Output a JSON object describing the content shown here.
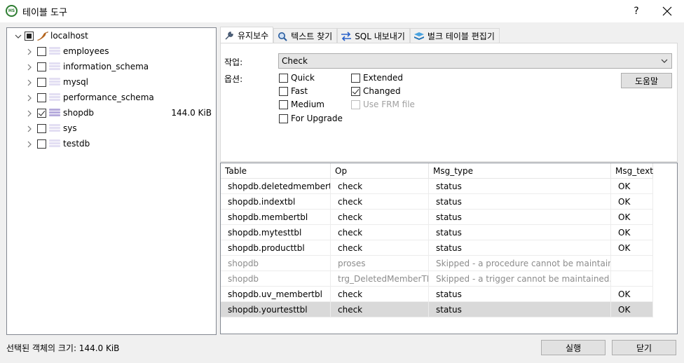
{
  "window": {
    "title": "테이블 도구",
    "help_label": "?",
    "app_icon_text": "HS"
  },
  "tree": {
    "root": {
      "label": "localhost",
      "state": "partial"
    },
    "items": [
      {
        "label": "employees",
        "checked": false,
        "size": ""
      },
      {
        "label": "information_schema",
        "checked": false,
        "size": ""
      },
      {
        "label": "mysql",
        "checked": false,
        "size": ""
      },
      {
        "label": "performance_schema",
        "checked": false,
        "size": ""
      },
      {
        "label": "shopdb",
        "checked": true,
        "size": "144.0 KiB"
      },
      {
        "label": "sys",
        "checked": false,
        "size": ""
      },
      {
        "label": "testdb",
        "checked": false,
        "size": ""
      }
    ]
  },
  "tabs": [
    {
      "label": "유지보수",
      "icon": "wrench-icon",
      "active": true
    },
    {
      "label": "텍스트 찾기",
      "icon": "magnifier-icon",
      "active": false
    },
    {
      "label": "SQL 내보내기",
      "icon": "export-arrows-icon",
      "active": false
    },
    {
      "label": "벌크 테이블 편집기",
      "icon": "stack-icon",
      "active": false
    }
  ],
  "maintenance": {
    "operation_label": "작업:",
    "operation_value": "Check",
    "options_label": "옵션:",
    "help_button": "도움말",
    "options": [
      {
        "label": "Quick",
        "checked": false,
        "disabled": false
      },
      {
        "label": "Fast",
        "checked": false,
        "disabled": false
      },
      {
        "label": "Medium",
        "checked": false,
        "disabled": false
      },
      {
        "label": "For Upgrade",
        "checked": false,
        "disabled": false
      },
      {
        "label": "Extended",
        "checked": false,
        "disabled": false
      },
      {
        "label": "Changed",
        "checked": true,
        "disabled": false
      },
      {
        "label": "Use FRM file",
        "checked": false,
        "disabled": true
      }
    ]
  },
  "results": {
    "columns": [
      "Table",
      "Op",
      "Msg_type",
      "Msg_text"
    ],
    "rows": [
      [
        "shopdb.deletedmembertbl",
        "check",
        "status",
        "OK"
      ],
      [
        "shopdb.indextbl",
        "check",
        "status",
        "OK"
      ],
      [
        "shopdb.membertbl",
        "check",
        "status",
        "OK"
      ],
      [
        "shopdb.mytesttbl",
        "check",
        "status",
        "OK"
      ],
      [
        "shopdb.producttbl",
        "check",
        "status",
        "OK"
      ],
      [
        "shopdb",
        "proses",
        "Skipped - a procedure cannot be maintained.",
        ""
      ],
      [
        "shopdb",
        "trg_DeletedMemberTBL",
        "Skipped - a trigger cannot be maintained.",
        ""
      ],
      [
        "shopdb.uv_membertbl",
        "check",
        "status",
        "OK"
      ],
      [
        "shopdb.yourtesttbl",
        "check",
        "status",
        "OK"
      ]
    ],
    "dim_rows": [
      5,
      6
    ],
    "selected_row": 8
  },
  "footer": {
    "status_text": "선택된 객체의 크기: 144.0 KiB",
    "run_button": "실행",
    "close_button": "닫기"
  },
  "colors": {
    "selection": "#d9d9d9",
    "db_icon_active": "#b6abdc",
    "db_icon_inactive": "#e3dff3",
    "app_icon": "#2e7d32"
  }
}
